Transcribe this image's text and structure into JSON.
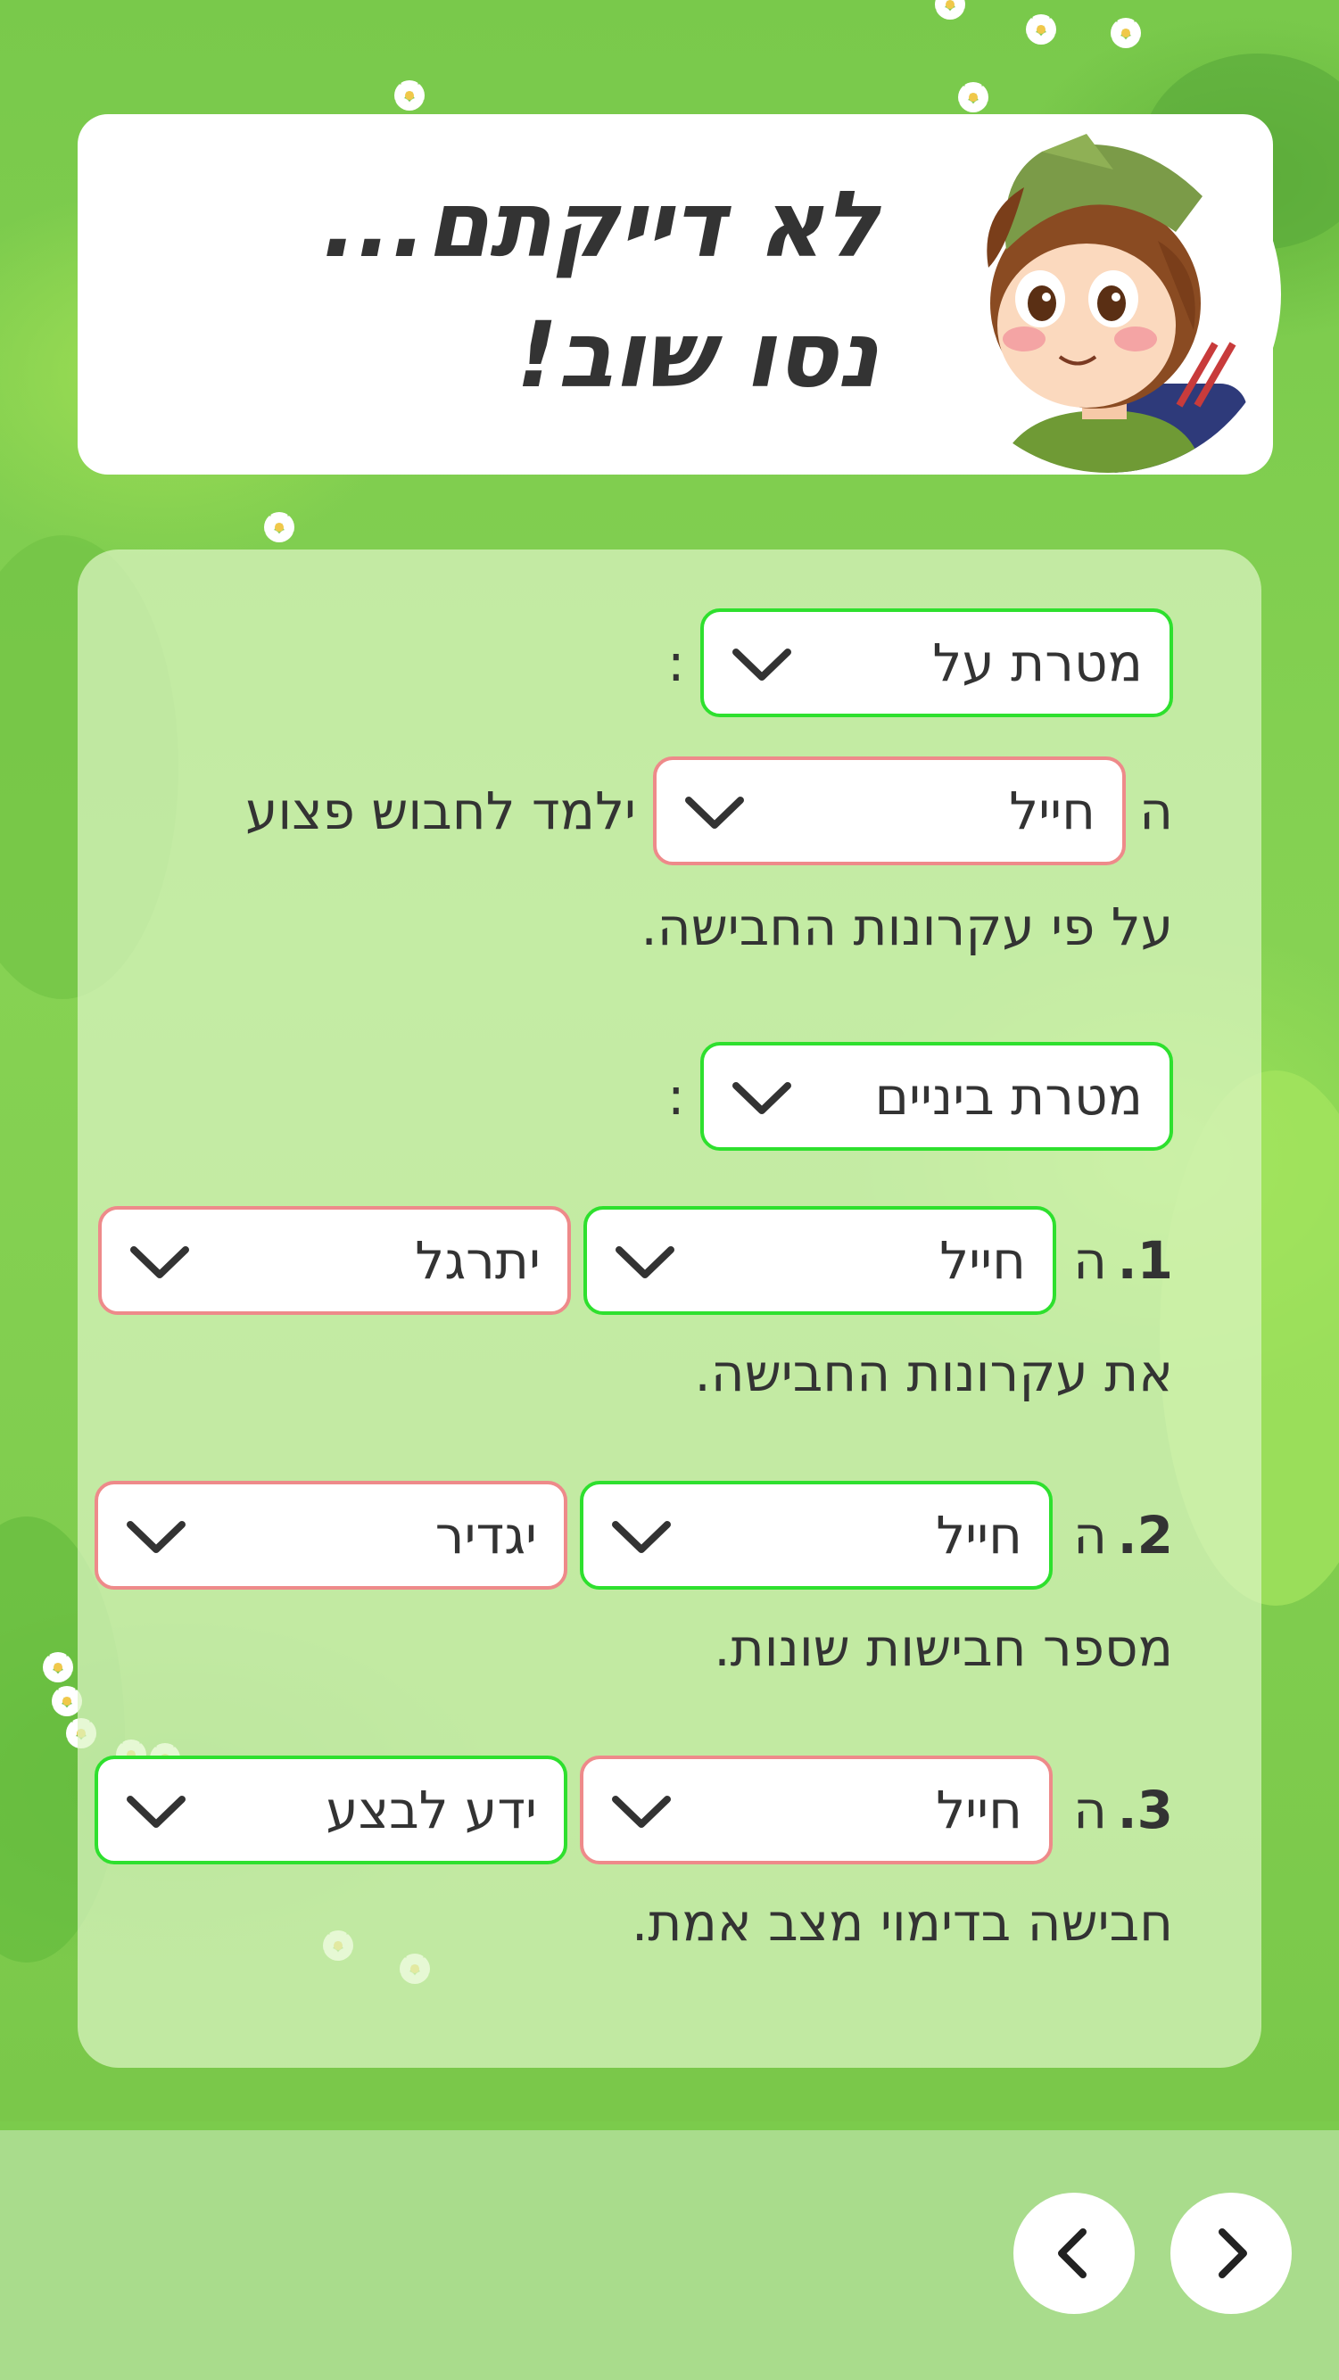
{
  "header": {
    "title_line1": "לא דייקתם...",
    "title_line2": "נסו שוב!"
  },
  "goal_section": {
    "goal_dropdown": {
      "value": "מטרת על"
    },
    "colon": ":",
    "line1_prefix": "ה",
    "soldier_dropdown": {
      "value": "חייל"
    },
    "line1_suffix": "ילמד לחבוש פצוע",
    "line2": "על פי עקרונות החבישה."
  },
  "intermediate_section": {
    "goal_dropdown": {
      "value": "מטרת ביניים"
    },
    "colon": ":",
    "items": [
      {
        "number": "1.",
        "prefix": "ה",
        "subject": "חייל",
        "verb": "יתרגל",
        "continuation": "את עקרונות החבישה."
      },
      {
        "number": "2.",
        "prefix": "ה",
        "subject": "חייל",
        "verb": "יגדיר",
        "continuation": "מספר חבישות שונות."
      },
      {
        "number": "3.",
        "prefix": "ה",
        "subject": "חייל",
        "verb": "ידע לבצע",
        "continuation": "חבישה בדימוי מצב אמת."
      }
    ]
  },
  "navigation": {
    "prev_icon": "chevron-left-icon",
    "next_icon": "chevron-right-icon"
  },
  "colors": {
    "correct_border": "#2ee02e",
    "incorrect_border": "#ee8a8a",
    "background_green": "#7bcb4c",
    "footer": "#a9dc8c"
  }
}
